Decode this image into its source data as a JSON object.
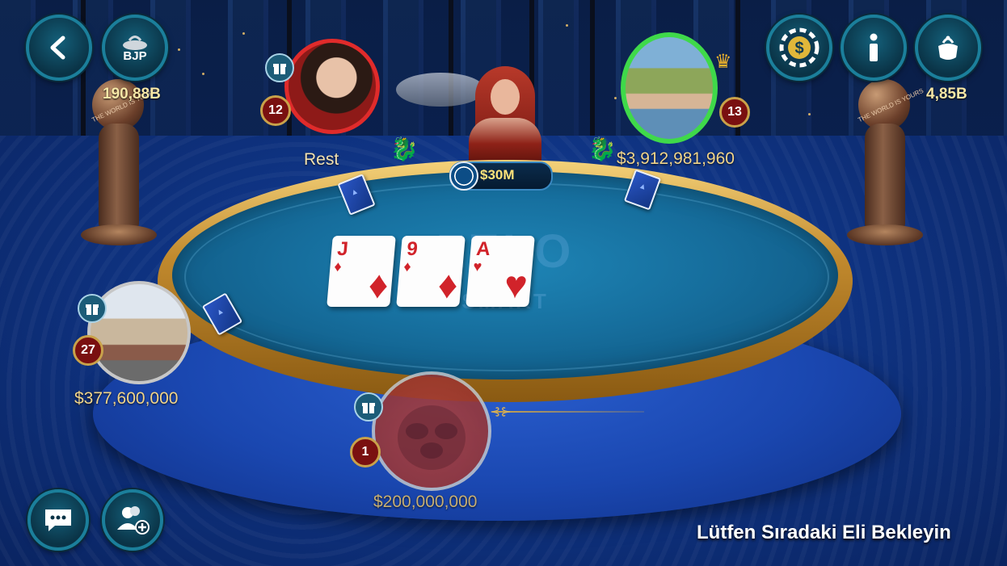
{
  "top_left": {
    "back_button": {
      "icon": "chevron-left-icon"
    },
    "jackpot_button": {
      "label": "BJP",
      "icon": "jackpot-pot-icon"
    },
    "jackpot_value": "190,88B"
  },
  "top_right": {
    "shop_button": {
      "icon": "dollar-chip-icon"
    },
    "info_button": {
      "icon": "info-icon"
    },
    "pot_button": {
      "icon": "cauldron-icon"
    },
    "pot_value": "4,85B"
  },
  "table": {
    "pot_amount": "$30M",
    "logo_text": "ZELO",
    "logo_subtext": "SMART",
    "community_cards": [
      {
        "rank": "J",
        "suit": "♦",
        "color": "#d1232a"
      },
      {
        "rank": "9",
        "suit": "♦",
        "color": "#d1232a"
      },
      {
        "rank": "A",
        "suit": "♥",
        "color": "#d1232a"
      }
    ]
  },
  "players": {
    "top_left": {
      "name": "Rest",
      "level": "12",
      "ring_color": "#e02b2b"
    },
    "top_right": {
      "chips": "$3,912,981,960",
      "level": "13",
      "ring_color": "#3fd94a",
      "has_crown": true
    },
    "left": {
      "chips": "$377,600,000",
      "level": "27"
    },
    "bottom": {
      "chips": "$200,000,000",
      "level": "1"
    }
  },
  "bottom_left": {
    "chat_button": {
      "icon": "chat-bubble-icon"
    },
    "add_friend_button": {
      "icon": "add-friend-icon"
    }
  },
  "status_message": "Lütfen Sıradaki Eli Bekleyin",
  "decor": {
    "statue_text_left": "THE WORLD IS YOURS",
    "statue_text_right": "THE WORLD IS YOURS"
  }
}
